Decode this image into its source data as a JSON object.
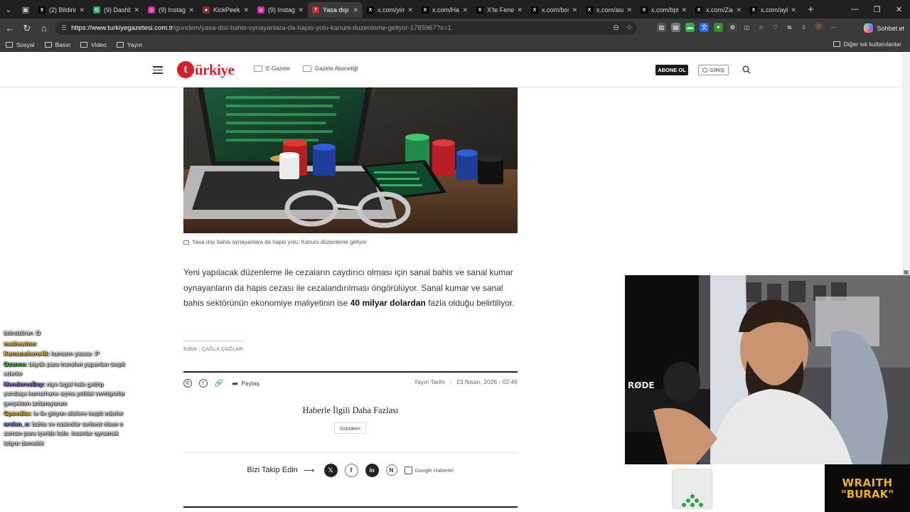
{
  "browser": {
    "tabs": [
      {
        "label": "(2) Bildirim",
        "fav": "X",
        "favColor": "#000000"
      },
      {
        "label": "(9) Dashbo",
        "fav": "G",
        "favColor": "#1fa463"
      },
      {
        "label": "(9) Instagra",
        "fav": "◎",
        "favColor": "#d6249f"
      },
      {
        "label": "KickPeek -",
        "fav": "●",
        "favColor": "#8b2c2c"
      },
      {
        "label": "(9) Instagra",
        "fav": "◎",
        "favColor": "#d6249f"
      },
      {
        "label": "Yasa dışı b",
        "fav": "T",
        "favColor": "#d21f2a",
        "active": true
      },
      {
        "label": "x.com/yim",
        "fav": "X",
        "favColor": "#000000"
      },
      {
        "label": "x.com/Hab",
        "fav": "X",
        "favColor": "#000000"
      },
      {
        "label": "X'te Fenert",
        "fav": "X",
        "favColor": "#000000"
      },
      {
        "label": "x.com/bos",
        "fav": "X",
        "favColor": "#000000"
      },
      {
        "label": "x.com/asa",
        "fav": "X",
        "favColor": "#000000"
      },
      {
        "label": "x.com/bpt",
        "fav": "X",
        "favColor": "#000000"
      },
      {
        "label": "x.com/Zam",
        "fav": "X",
        "favColor": "#000000"
      },
      {
        "label": "x.com/ayk",
        "fav": "X",
        "favColor": "#000000"
      }
    ],
    "url_host": "https://www.turkiyegazetesi.com.tr",
    "url_path": "/gundem/yasa-disi-bahis-oynayanlara-da-hapis-yolu-kanuni-duzenleme-geliyor-1785967?s=1",
    "sohbet_label": "Sohbet et",
    "bookmarks": [
      "Sosyal",
      "Basın",
      "Video",
      "Yayın"
    ],
    "bookmarks_other": "Diğer sık kullanılanlar"
  },
  "site": {
    "logo_mark": "t",
    "logo_text": "ürkiye",
    "egazete": "E-Gazete",
    "abonelik": "Gazete Aboneliği",
    "abone": "ABONE OL",
    "giris": "GİRİŞ"
  },
  "article": {
    "caption": "Yasa dışı bahis oynayanlara da hapis yolu: Kanuni düzenleme geliyor",
    "p1": "Yeni yapılacak düzenleme ile cezaların caydırıcı olması için sanal bahis ve sanal kumar oynayanların da hapis cezası ile cezalandırılması öngörülüyor. Sanal kumar ve sanal bahis sektörünün ekonomiye maliyetinin ise ",
    "p1_bold": "40 milyar dolardan",
    "p1_end": " fazla olduğu belirtiliyor.",
    "editor": "Editör : ÇAĞLA ÇAĞLAR",
    "share": "Paylaş",
    "pub_label": "Yayın Tarihi",
    "pub_date": "23 Nisan, 2026 - 02:46",
    "related_title": "Haberle İlgili Daha Fazlası",
    "tag": "Gündem",
    "follow_label": "Bizi Takip Edin",
    "follow_arrow": "⟶",
    "google_news": "Google Haberler"
  },
  "chat": [
    {
      "user": "",
      "text": "bitirebiliren :D",
      "color": "#ffffff"
    },
    {
      "user": "mathewine:",
      "text": "",
      "color": "#ffd24a"
    },
    {
      "user": "Komanchero46:",
      "text": "kumarın yasası :P",
      "color": "#ffd24a"
    },
    {
      "user": "Ozanee:",
      "text": "büyük para transferi yapanları tespit ederler",
      "color": "#3fd64a"
    },
    {
      "user": "MenderesBey:",
      "text": "niye legal hale getirip yandaşa kumarhane açma yetkisi vermiyorlar gerçekten anlamıyorum",
      "color": "#9b6bff"
    },
    {
      "user": "Gpcedits:",
      "text": "te ile giriyon sitelere tespit ederler",
      "color": "#ffd24a"
    },
    {
      "user": "arslan_e:",
      "text": "bahis ve casinolar serbest olsun o zaman para içeride kalır. insanlar oynamak istiyor demekki",
      "color": "#6a8dff"
    }
  ],
  "stream": {
    "brand_line1": "WRAITH",
    "brand_line2": "\"BURAK\""
  }
}
